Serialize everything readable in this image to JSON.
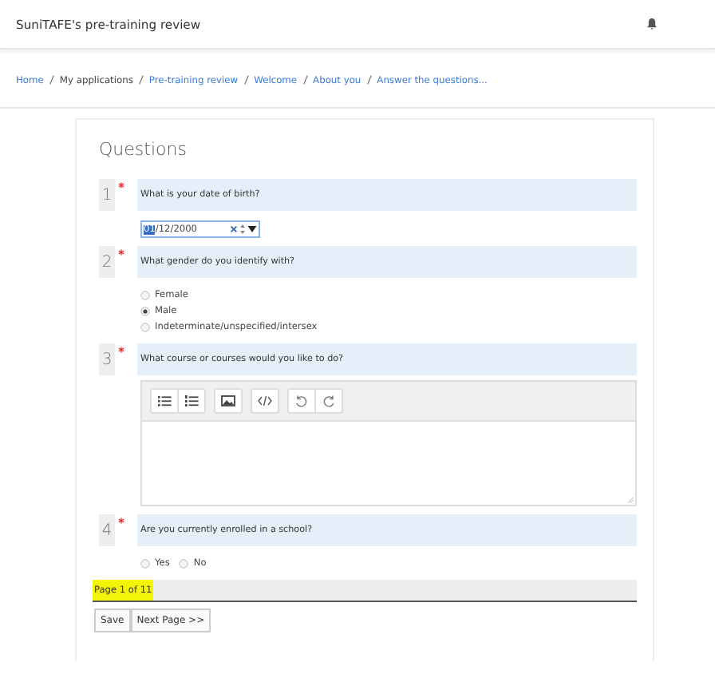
{
  "header": {
    "title": "SuniTAFE's pre-training review"
  },
  "breadcrumb": [
    {
      "label": "Home",
      "link": true
    },
    {
      "label": "My applications",
      "link": false
    },
    {
      "label": "Pre-training review",
      "link": true
    },
    {
      "label": "Welcome",
      "link": true
    },
    {
      "label": "About you",
      "link": true
    },
    {
      "label": "Answer the questions...",
      "link": true
    }
  ],
  "heading": "Questions",
  "questions": [
    {
      "number": "1",
      "required": true,
      "text": "What is your date of birth?",
      "kind": "date",
      "separator": "/",
      "parts": [
        {
          "text": "01",
          "selected": true
        },
        {
          "text": "12",
          "selected": false
        },
        {
          "text": "2000",
          "selected": false
        }
      ]
    },
    {
      "number": "2",
      "required": true,
      "text": "What gender do you identify with?",
      "kind": "radio",
      "inline": false,
      "options": [
        {
          "label": "Female",
          "selected": false
        },
        {
          "label": "Male",
          "selected": true
        },
        {
          "label": "Indeterminate/unspecified/intersex",
          "selected": false
        }
      ]
    },
    {
      "number": "3",
      "required": true,
      "text": "What course or courses would you like to do?",
      "kind": "editor"
    },
    {
      "number": "4",
      "required": true,
      "text": "Are you currently enrolled in a school?",
      "kind": "radio",
      "inline": true,
      "options": [
        {
          "label": "Yes",
          "selected": false
        },
        {
          "label": "No",
          "selected": false
        }
      ]
    }
  ],
  "page_indicator": {
    "text": "Page 1 of 11",
    "highlighted": true
  },
  "buttons": [
    "Save",
    "Next Page >>"
  ]
}
